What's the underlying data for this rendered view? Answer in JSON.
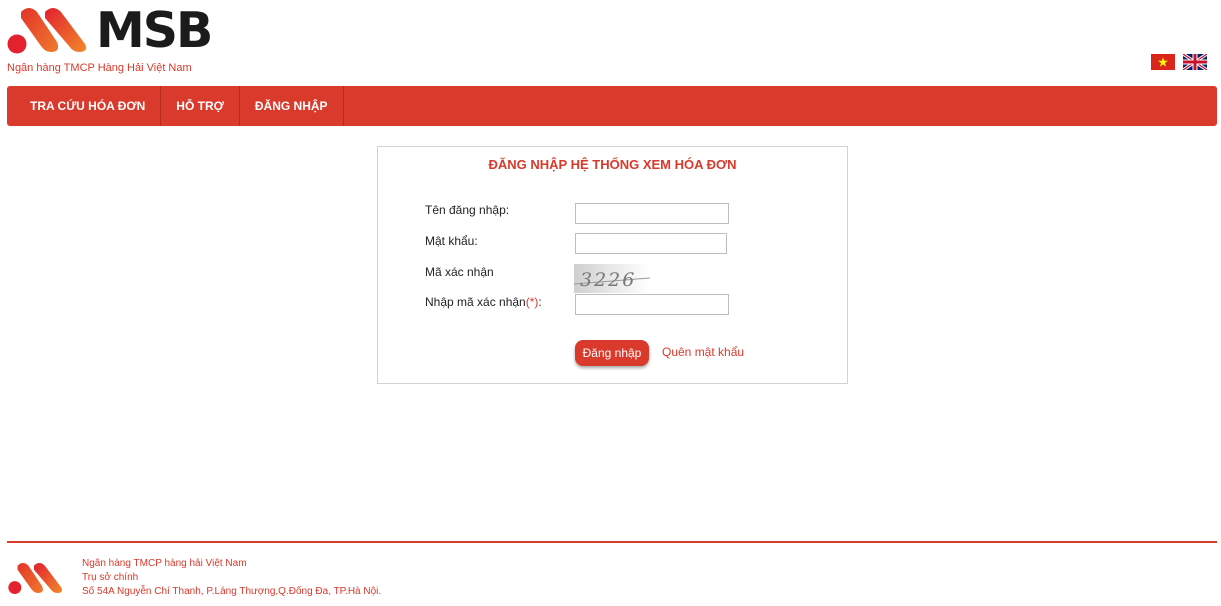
{
  "brand": {
    "name": "MSB",
    "tagline": "Ngân hàng TMCP Hàng Hải Việt Nam",
    "color": "#d93a2b"
  },
  "languages": [
    {
      "icon": "vietnam-flag-icon"
    },
    {
      "icon": "uk-flag-icon"
    }
  ],
  "nav": {
    "items": [
      {
        "label": "TRA CỨU HÓA ĐƠN"
      },
      {
        "label": "HỖ TRỢ"
      },
      {
        "label": "ĐĂNG NHẬP"
      }
    ]
  },
  "login": {
    "title": "ĐĂNG NHẬP HỆ THỐNG XEM HÓA ĐƠN",
    "username_label": "Tên đăng nhập:",
    "username_value": "",
    "password_label": "Mật khẩu:",
    "password_value": "",
    "captcha_label": "Mã xác nhận",
    "captcha_code": "3226",
    "captcha_input_label": "Nhập mã xác nhận",
    "captcha_required_marker": "(*)",
    "captcha_input_suffix": ":",
    "captcha_input_value": "",
    "submit_label": "Đăng nhập",
    "forgot_label": "Quên mật khẩu"
  },
  "footer": {
    "line1": "Ngân hàng TMCP hàng hải Việt Nam",
    "line2": "Trụ sở chính",
    "line3": "Số 54A Nguyễn Chí Thanh, P.Láng Thượng,Q.Đống Đa, TP.Hà Nội."
  }
}
